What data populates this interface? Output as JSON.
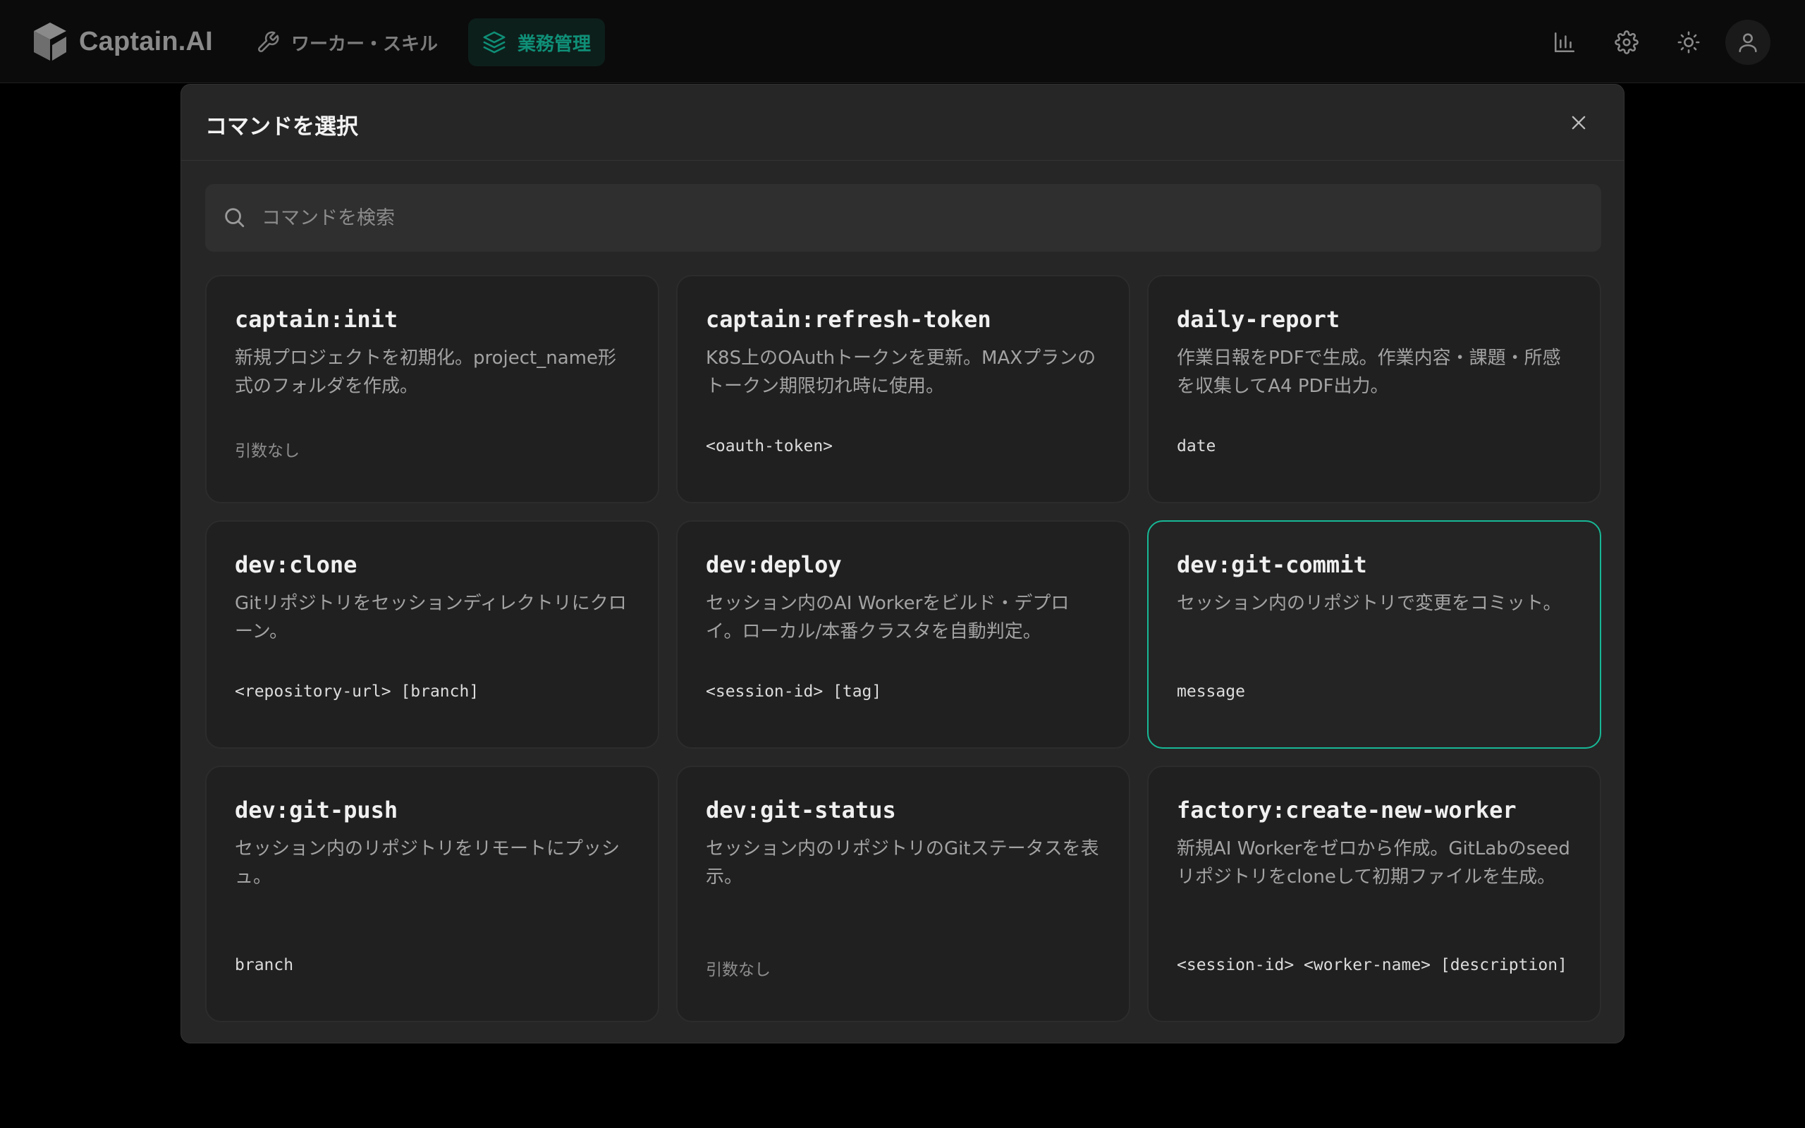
{
  "app": {
    "name": "Captain.AI",
    "nav": [
      {
        "label": "ワーカー・スキル",
        "icon": "wrench-icon",
        "active": false
      },
      {
        "label": "業務管理",
        "icon": "layers-icon",
        "active": true
      }
    ],
    "top_icons": [
      "bar-chart-icon",
      "gear-icon",
      "sun-icon",
      "user-icon"
    ],
    "accent_color": "#17b896"
  },
  "modal": {
    "title": "コマンドを選択",
    "search_placeholder": "コマンドを検索",
    "search_value": "",
    "commands": [
      {
        "name": "captain:init",
        "description": "新規プロジェクトを初期化。project_name形式のフォルダを作成。",
        "args": "引数なし",
        "selected": false
      },
      {
        "name": "captain:refresh-token",
        "description": "K8S上のOAuthトークンを更新。MAXプランのトークン期限切れ時に使用。",
        "args": "<oauth-token>",
        "selected": false
      },
      {
        "name": "daily-report",
        "description": "作業日報をPDFで生成。作業内容・課題・所感を収集してA4 PDF出力。",
        "args": "date",
        "selected": false
      },
      {
        "name": "dev:clone",
        "description": "Gitリポジトリをセッションディレクトリにクローン。",
        "args": "<repository-url> [branch]",
        "selected": false
      },
      {
        "name": "dev:deploy",
        "description": "セッション内のAI Workerをビルド・デプロイ。ローカル/本番クラスタを自動判定。",
        "args": "<session-id> [tag]",
        "selected": false
      },
      {
        "name": "dev:git-commit",
        "description": "セッション内のリポジトリで変更をコミット。",
        "args": "message",
        "selected": true
      },
      {
        "name": "dev:git-push",
        "description": "セッション内のリポジトリをリモートにプッシュ。",
        "args": "branch",
        "selected": false
      },
      {
        "name": "dev:git-status",
        "description": "セッション内のリポジトリのGitステータスを表示。",
        "args": "引数なし",
        "selected": false
      },
      {
        "name": "factory:create-new-worker",
        "description": "新規AI Workerをゼロから作成。GitLabのseedリポジトリをcloneして初期ファイルを生成。",
        "args": "<session-id> <worker-name> [description]",
        "selected": false
      }
    ]
  }
}
